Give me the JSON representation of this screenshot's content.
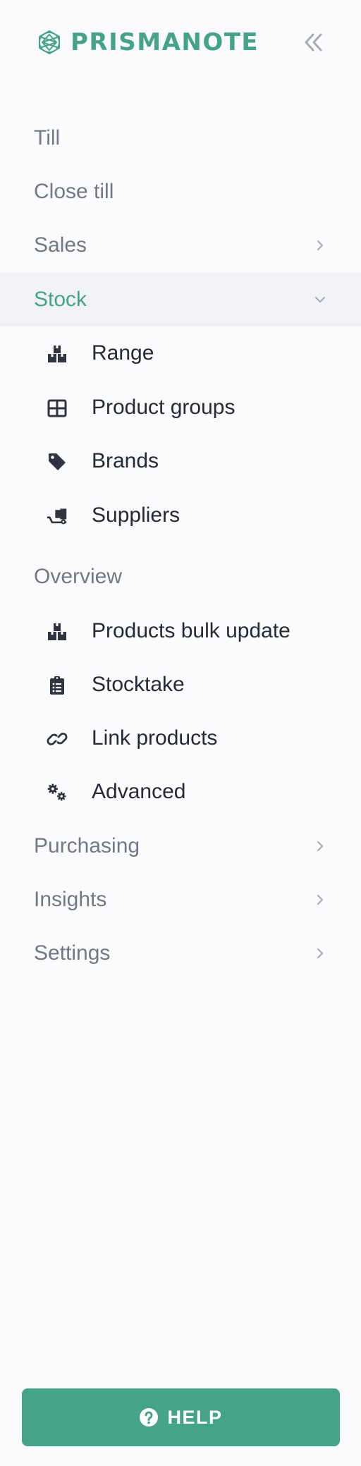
{
  "brand": {
    "name": "PRISMANOTE",
    "color": "#45a389"
  },
  "header": {
    "collapse_icon": "double-chevron-left-icon"
  },
  "nav": {
    "till": "Till",
    "close_till": "Close till",
    "sales": "Sales",
    "stock": "Stock",
    "stock_items": [
      {
        "label": "Range",
        "icon": "boxes-icon"
      },
      {
        "label": "Product groups",
        "icon": "grid-icon"
      },
      {
        "label": "Brands",
        "icon": "tag-icon"
      },
      {
        "label": "Suppliers",
        "icon": "dolly-icon"
      }
    ],
    "overview": "Overview",
    "overview_items": [
      {
        "label": "Products bulk update",
        "icon": "boxes-icon"
      },
      {
        "label": "Stocktake",
        "icon": "clipboard-list-icon"
      },
      {
        "label": "Link products",
        "icon": "link-icon"
      },
      {
        "label": "Advanced",
        "icon": "cogs-icon"
      }
    ],
    "purchasing": "Purchasing",
    "insights": "Insights",
    "settings": "Settings"
  },
  "help": {
    "label": "HELP",
    "icon": "question-circle-icon"
  }
}
